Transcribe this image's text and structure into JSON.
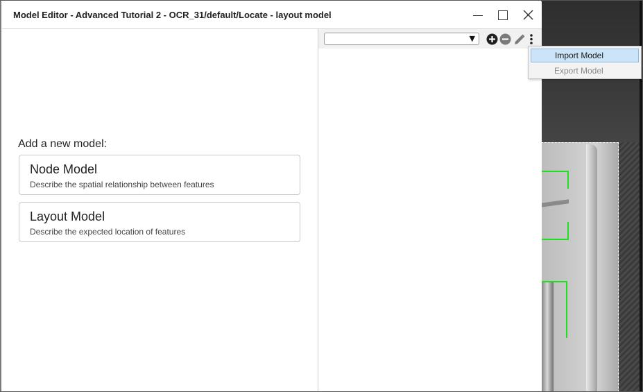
{
  "window": {
    "title": "Model Editor - Advanced Tutorial 2 - OCR_31/default/Locate - layout model",
    "controls": [
      "minimize-icon",
      "maximize-icon",
      "close-icon"
    ]
  },
  "left_pane": {
    "heading": "Add a new model:",
    "cards": [
      {
        "title": "Node Model",
        "description": "Describe the spatial relationship between features"
      },
      {
        "title": "Layout Model",
        "description": "Describe the expected location of features"
      }
    ]
  },
  "right_pane": {
    "model_select": {
      "value": ""
    },
    "toolbar_icons": [
      "add-circle-icon",
      "remove-circle-icon",
      "pencil-icon",
      "more-vertical-icon"
    ]
  },
  "menu": {
    "items": [
      {
        "label": "Import Model",
        "highlighted": true,
        "enabled": true
      },
      {
        "label": "Export Model",
        "highlighted": false,
        "enabled": false
      }
    ]
  },
  "colors": {
    "menu_highlight": "#cce4f7",
    "roi_green": "#1ee01e"
  }
}
